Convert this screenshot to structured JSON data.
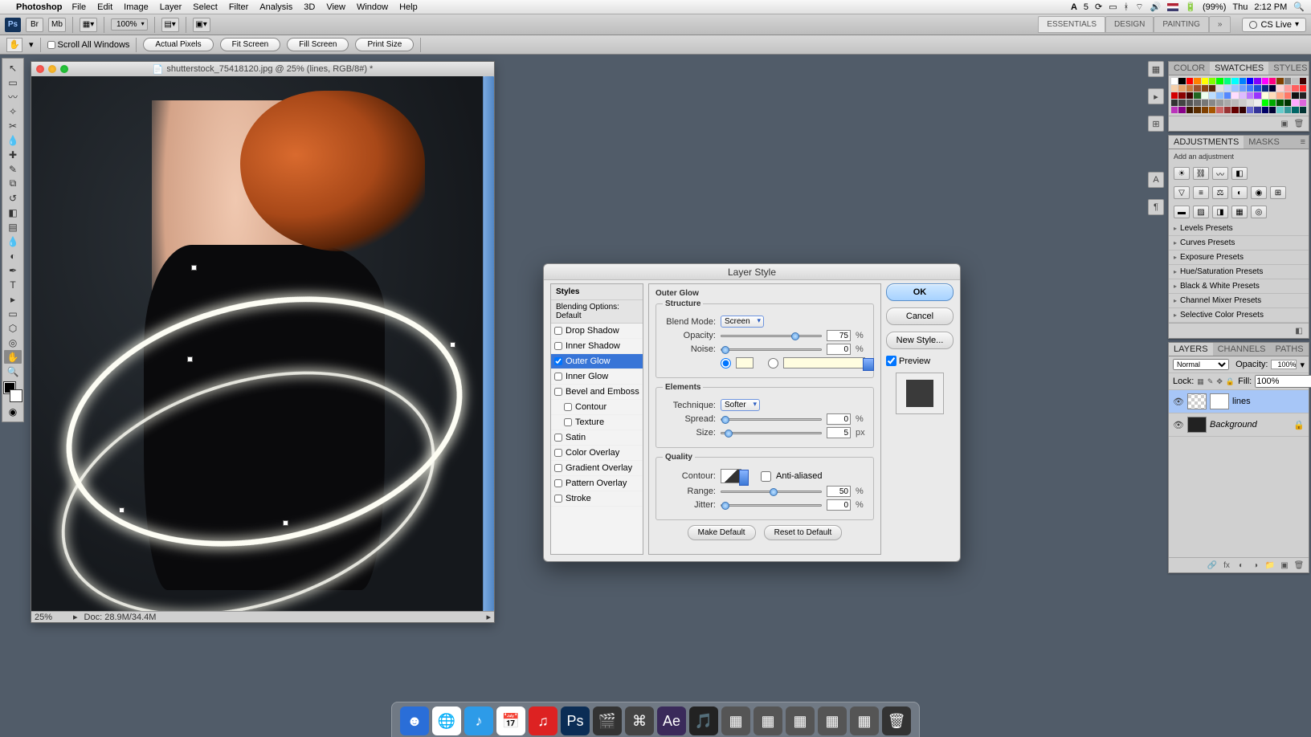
{
  "menubar": {
    "app": "Photoshop",
    "items": [
      "File",
      "Edit",
      "Image",
      "Layer",
      "Select",
      "Filter",
      "Analysis",
      "3D",
      "View",
      "Window",
      "Help"
    ],
    "right": {
      "adobe_count": "5",
      "battery": "(99%)",
      "day": "Thu",
      "time": "2:12 PM"
    }
  },
  "appbar": {
    "zoom": "100%",
    "workspaces": [
      "ESSENTIALS",
      "DESIGN",
      "PAINTING"
    ],
    "more": "»",
    "cslive": "CS Live"
  },
  "options": {
    "scroll_all": "Scroll All Windows",
    "buttons": [
      "Actual Pixels",
      "Fit Screen",
      "Fill Screen",
      "Print Size"
    ]
  },
  "doc": {
    "title": "shutterstock_75418120.jpg @ 25% (lines, RGB/8#) *",
    "status_zoom": "25%",
    "status_doc": "Doc: 28.9M/34.4M"
  },
  "dialog": {
    "title": "Layer Style",
    "styles_header": "Styles",
    "blending": "Blending Options: Default",
    "styles": [
      "Drop Shadow",
      "Inner Shadow",
      "Outer Glow",
      "Inner Glow",
      "Bevel and Emboss",
      "Contour",
      "Texture",
      "Satin",
      "Color Overlay",
      "Gradient Overlay",
      "Pattern Overlay",
      "Stroke"
    ],
    "section": "Outer Glow",
    "structure": {
      "legend": "Structure",
      "blend_label": "Blend Mode:",
      "blend_value": "Screen",
      "opacity_label": "Opacity:",
      "opacity": "75",
      "pct": "%",
      "noise_label": "Noise:",
      "noise": "0"
    },
    "elements": {
      "legend": "Elements",
      "technique_label": "Technique:",
      "technique": "Softer",
      "spread_label": "Spread:",
      "spread": "0",
      "size_label": "Size:",
      "size": "5",
      "px": "px"
    },
    "quality": {
      "legend": "Quality",
      "contour_label": "Contour:",
      "anti": "Anti-aliased",
      "range_label": "Range:",
      "range": "50",
      "jitter_label": "Jitter:",
      "jitter": "0"
    },
    "make_default": "Make Default",
    "reset_default": "Reset to Default",
    "ok": "OK",
    "cancel": "Cancel",
    "new_style": "New Style...",
    "preview": "Preview"
  },
  "panels": {
    "color_tabs": [
      "COLOR",
      "SWATCHES",
      "STYLES"
    ],
    "adjust_tabs": [
      "ADJUSTMENTS",
      "MASKS"
    ],
    "add_adj": "Add an adjustment",
    "presets": [
      "Levels Presets",
      "Curves Presets",
      "Exposure Presets",
      "Hue/Saturation Presets",
      "Black & White Presets",
      "Channel Mixer Presets",
      "Selective Color Presets"
    ],
    "layers_tabs": [
      "LAYERS",
      "CHANNELS",
      "PATHS"
    ],
    "blend_mode": "Normal",
    "opacity_label": "Opacity:",
    "opacity_val": "100%",
    "lock_label": "Lock:",
    "fill_label": "Fill:",
    "fill_val": "100%",
    "layers": [
      {
        "name": "lines"
      },
      {
        "name": "Background"
      }
    ]
  },
  "swatch_colors": [
    "#fff",
    "#000",
    "#ff0000",
    "#ff8000",
    "#ffff00",
    "#80ff00",
    "#00ff00",
    "#00ff80",
    "#00ffff",
    "#0080ff",
    "#0000ff",
    "#8000ff",
    "#ff00ff",
    "#ff0080",
    "#804000",
    "#808080",
    "#c0c0c0",
    "#400000",
    "#f5cfa9",
    "#e6a66e",
    "#c97b3e",
    "#a0522d",
    "#8b4513",
    "#5a2b0b",
    "#e0e0e0",
    "#bed2ff",
    "#9cc0ff",
    "#6f9eff",
    "#3f7cff",
    "#1b52d8",
    "#0b2a80",
    "#003",
    "#ffd4d4",
    "#ff9e9e",
    "#ff5e5e",
    "#ff2a2a",
    "#d40000",
    "#8b0000",
    "#400",
    "#262",
    "#efe",
    "#bdf",
    "#8bf",
    "#58f",
    "#fdf",
    "#dbf",
    "#b7f",
    "#93f",
    "#ffd",
    "#fdb",
    "#fa8",
    "#f76",
    "#111",
    "#222",
    "#333",
    "#444",
    "#555",
    "#666",
    "#777",
    "#888",
    "#999",
    "#aaa",
    "#bbb",
    "#ccc",
    "#ddd",
    "#eee",
    "#0f0",
    "#0a0",
    "#050",
    "#030",
    "#faf",
    "#d6d",
    "#b3b",
    "#808",
    "#3a1a00",
    "#5c2e00",
    "#804000",
    "#a65600",
    "#c66",
    "#933",
    "#600",
    "#300",
    "#66c",
    "#339",
    "#006",
    "#003",
    "#6cc",
    "#399",
    "#066",
    "#033"
  ]
}
